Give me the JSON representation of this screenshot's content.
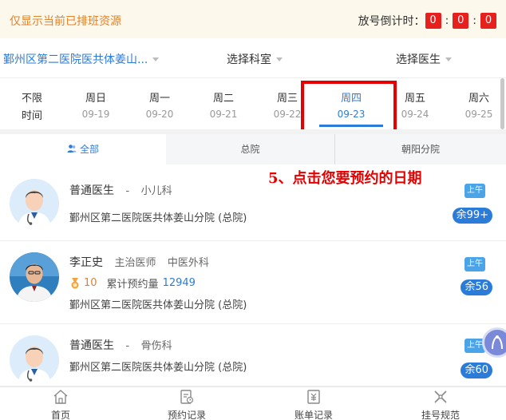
{
  "notice": {
    "text": "仅显示当前已排班资源",
    "countdown_label": "放号倒计时：",
    "countdown": [
      "0",
      "0",
      "0"
    ],
    "separator": ":"
  },
  "filters": {
    "hospital": "鄞州区第二医院医共体姜山...",
    "department": "选择科室",
    "doctor": "选择医生"
  },
  "dates": [
    {
      "weekday": "不限",
      "date": "时间"
    },
    {
      "weekday": "周日",
      "date": "09-19"
    },
    {
      "weekday": "周一",
      "date": "09-20"
    },
    {
      "weekday": "周二",
      "date": "09-21"
    },
    {
      "weekday": "周三",
      "date": "09-22"
    },
    {
      "weekday": "周四",
      "date": "09-23",
      "active": true
    },
    {
      "weekday": "周五",
      "date": "09-24"
    },
    {
      "weekday": "周六",
      "date": "09-25"
    }
  ],
  "branches": {
    "all": "全部",
    "main": "总院",
    "chaoyang": "朝阳分院"
  },
  "annotation": "5、点击您要预约的日期",
  "doctors": [
    {
      "name": "普通医生",
      "separator": "-",
      "department": "小儿科",
      "hospital": "鄞州区第二医院医共体姜山分院 (总院)",
      "slot": "上午",
      "remain": "余99+"
    },
    {
      "name": "李正史",
      "title": "主治医师",
      "department": "中医外科",
      "score": "10",
      "stat_label": "累计预约量",
      "stat_value": "12949",
      "hospital": "鄞州区第二医院医共体姜山分院 (总院)",
      "slot": "上午",
      "remain": "余56"
    },
    {
      "name": "普通医生",
      "separator": "-",
      "department": "骨伤科",
      "hospital": "鄞州区第二医院医共体姜山分院 (总院)",
      "slot": "上午",
      "remain": "余60"
    }
  ],
  "tabbar": {
    "home": "首页",
    "records": "预约记录",
    "bills": "账单记录",
    "rules": "挂号规范"
  },
  "colors": {
    "accent": "#2b7cd9",
    "warning": "#e2822a",
    "alert": "#e60000"
  }
}
